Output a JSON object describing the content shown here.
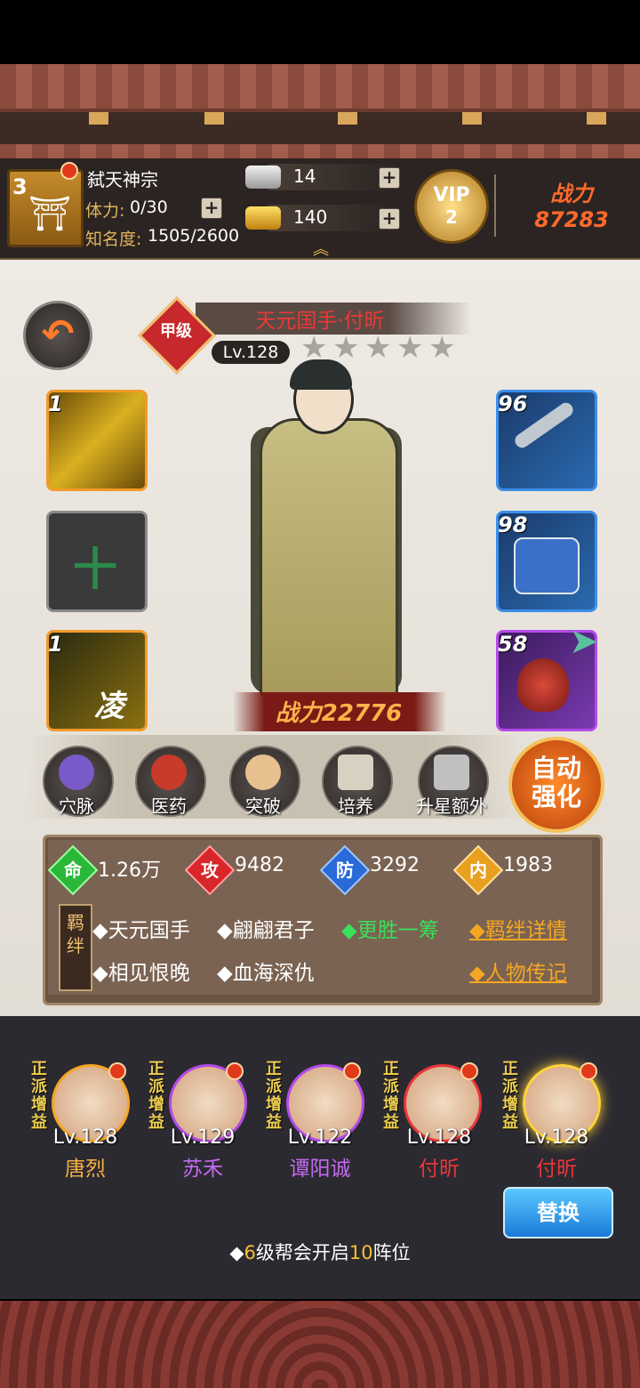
{
  "header": {
    "sect_level": "3",
    "sect_name": "弑天神宗",
    "stamina_label": "体力:",
    "stamina_value": "0/30",
    "fame_label": "知名度:",
    "fame_value": "1505/2600",
    "silver": "14",
    "gold": "140",
    "vip_label": "VIP",
    "vip_level": "2",
    "power_label": "战力",
    "power_value": "87283"
  },
  "hero": {
    "grade": "甲级",
    "name": "天元国手·付昕",
    "level": "Lv.128",
    "stars": 5,
    "power": "战力22776"
  },
  "slots": {
    "left": [
      {
        "num": "1",
        "kind": "skill"
      },
      {
        "num": "",
        "kind": "empty",
        "glyph": "十"
      },
      {
        "num": "1",
        "kind": "skill",
        "glyph": "凌"
      }
    ],
    "right": [
      {
        "num": "96",
        "kind": "weapon"
      },
      {
        "num": "98",
        "kind": "armor"
      },
      {
        "num": "58",
        "kind": "accessory"
      }
    ]
  },
  "functions": [
    "穴脉",
    "医药",
    "突破",
    "培养",
    "升星额外"
  ],
  "auto_button": {
    "line1": "自动",
    "line2": "强化"
  },
  "stats": [
    {
      "glyph": "命",
      "value": "1.26万",
      "color": "#2bb83a"
    },
    {
      "glyph": "攻",
      "value": "9482",
      "color": "#d8262a"
    },
    {
      "glyph": "防",
      "value": "3292",
      "color": "#2a6ad8"
    },
    {
      "glyph": "内",
      "value": "1983",
      "color": "#e8a020"
    }
  ],
  "bonds": {
    "tag": "羁绊",
    "row1": [
      "◆天元国手",
      "◆翩翩君子"
    ],
    "row1_active": "◆更胜一筹",
    "row2": [
      "◆相见恨晚",
      "◆血海深仇"
    ],
    "link_detail": "◆羁绊详情",
    "link_bio": "◆人物传记"
  },
  "team": [
    {
      "tag": "正派增益",
      "level": "Lv.128",
      "name": "唐烈",
      "name_color": "#f5b043",
      "ring": "#f5a623"
    },
    {
      "tag": "正派增益",
      "level": "Lv.129",
      "name": "苏禾",
      "name_color": "#c46af0",
      "ring": "#b44ae8"
    },
    {
      "tag": "正派增益",
      "level": "Lv.122",
      "name": "谭阳诚",
      "name_color": "#c46af0",
      "ring": "#b44ae8"
    },
    {
      "tag": "正派增益",
      "level": "Lv.128",
      "name": "付昕",
      "name_color": "#e8363a",
      "ring": "#e8363a"
    },
    {
      "tag": "正派增益",
      "level": "Lv.128",
      "name": "付昕",
      "name_color": "#e8363a",
      "ring": "#ffd23a"
    }
  ],
  "swap_button": "替换",
  "notice": {
    "prefix": "◆",
    "n1": "6",
    "mid": "级帮会开启",
    "n2": "10",
    "suffix": "阵位"
  },
  "colors": {
    "accent_gold": "#f5a623",
    "highlight": "#ffd23a",
    "active_bond": "#3adf5a"
  }
}
